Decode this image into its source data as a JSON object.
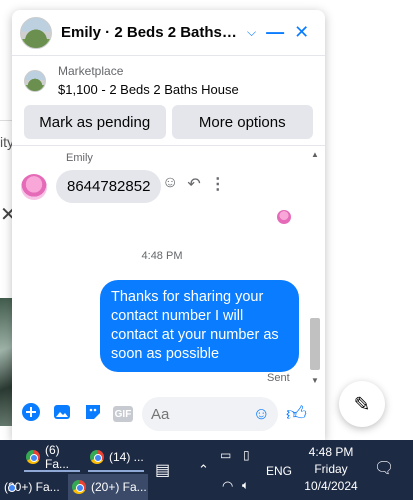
{
  "background": {
    "fragment_text": "ity",
    "close_glyph": "✕"
  },
  "chat": {
    "title": "Emily · 2 Beds 2 Baths House",
    "marketplace": {
      "label": "Marketplace",
      "item": "$1,100 - 2 Beds 2 Baths House",
      "mark_pending_label": "Mark as pending",
      "more_options_label": "More options"
    },
    "messages": {
      "sender_name": "Emily",
      "incoming_text": "8644782852",
      "timestamp": "4:48 PM",
      "outgoing_text": "Thanks for sharing your contact number I will contact at your number as soon as possible",
      "status": "Sent"
    },
    "composer": {
      "placeholder": "Aa",
      "gif_label": "GIF"
    }
  },
  "taskbar": {
    "windows": [
      {
        "label": "(6) Fa..."
      },
      {
        "label": "(14) ..."
      },
      {
        "label": "(20+) Fa..."
      },
      {
        "label": "(20+) Fa..."
      }
    ],
    "language": "ENG",
    "time": "4:48 PM",
    "day": "Friday",
    "date": "10/4/2024"
  },
  "colors": {
    "accent": "#0a7cff",
    "taskbar": "#1d2a44"
  }
}
